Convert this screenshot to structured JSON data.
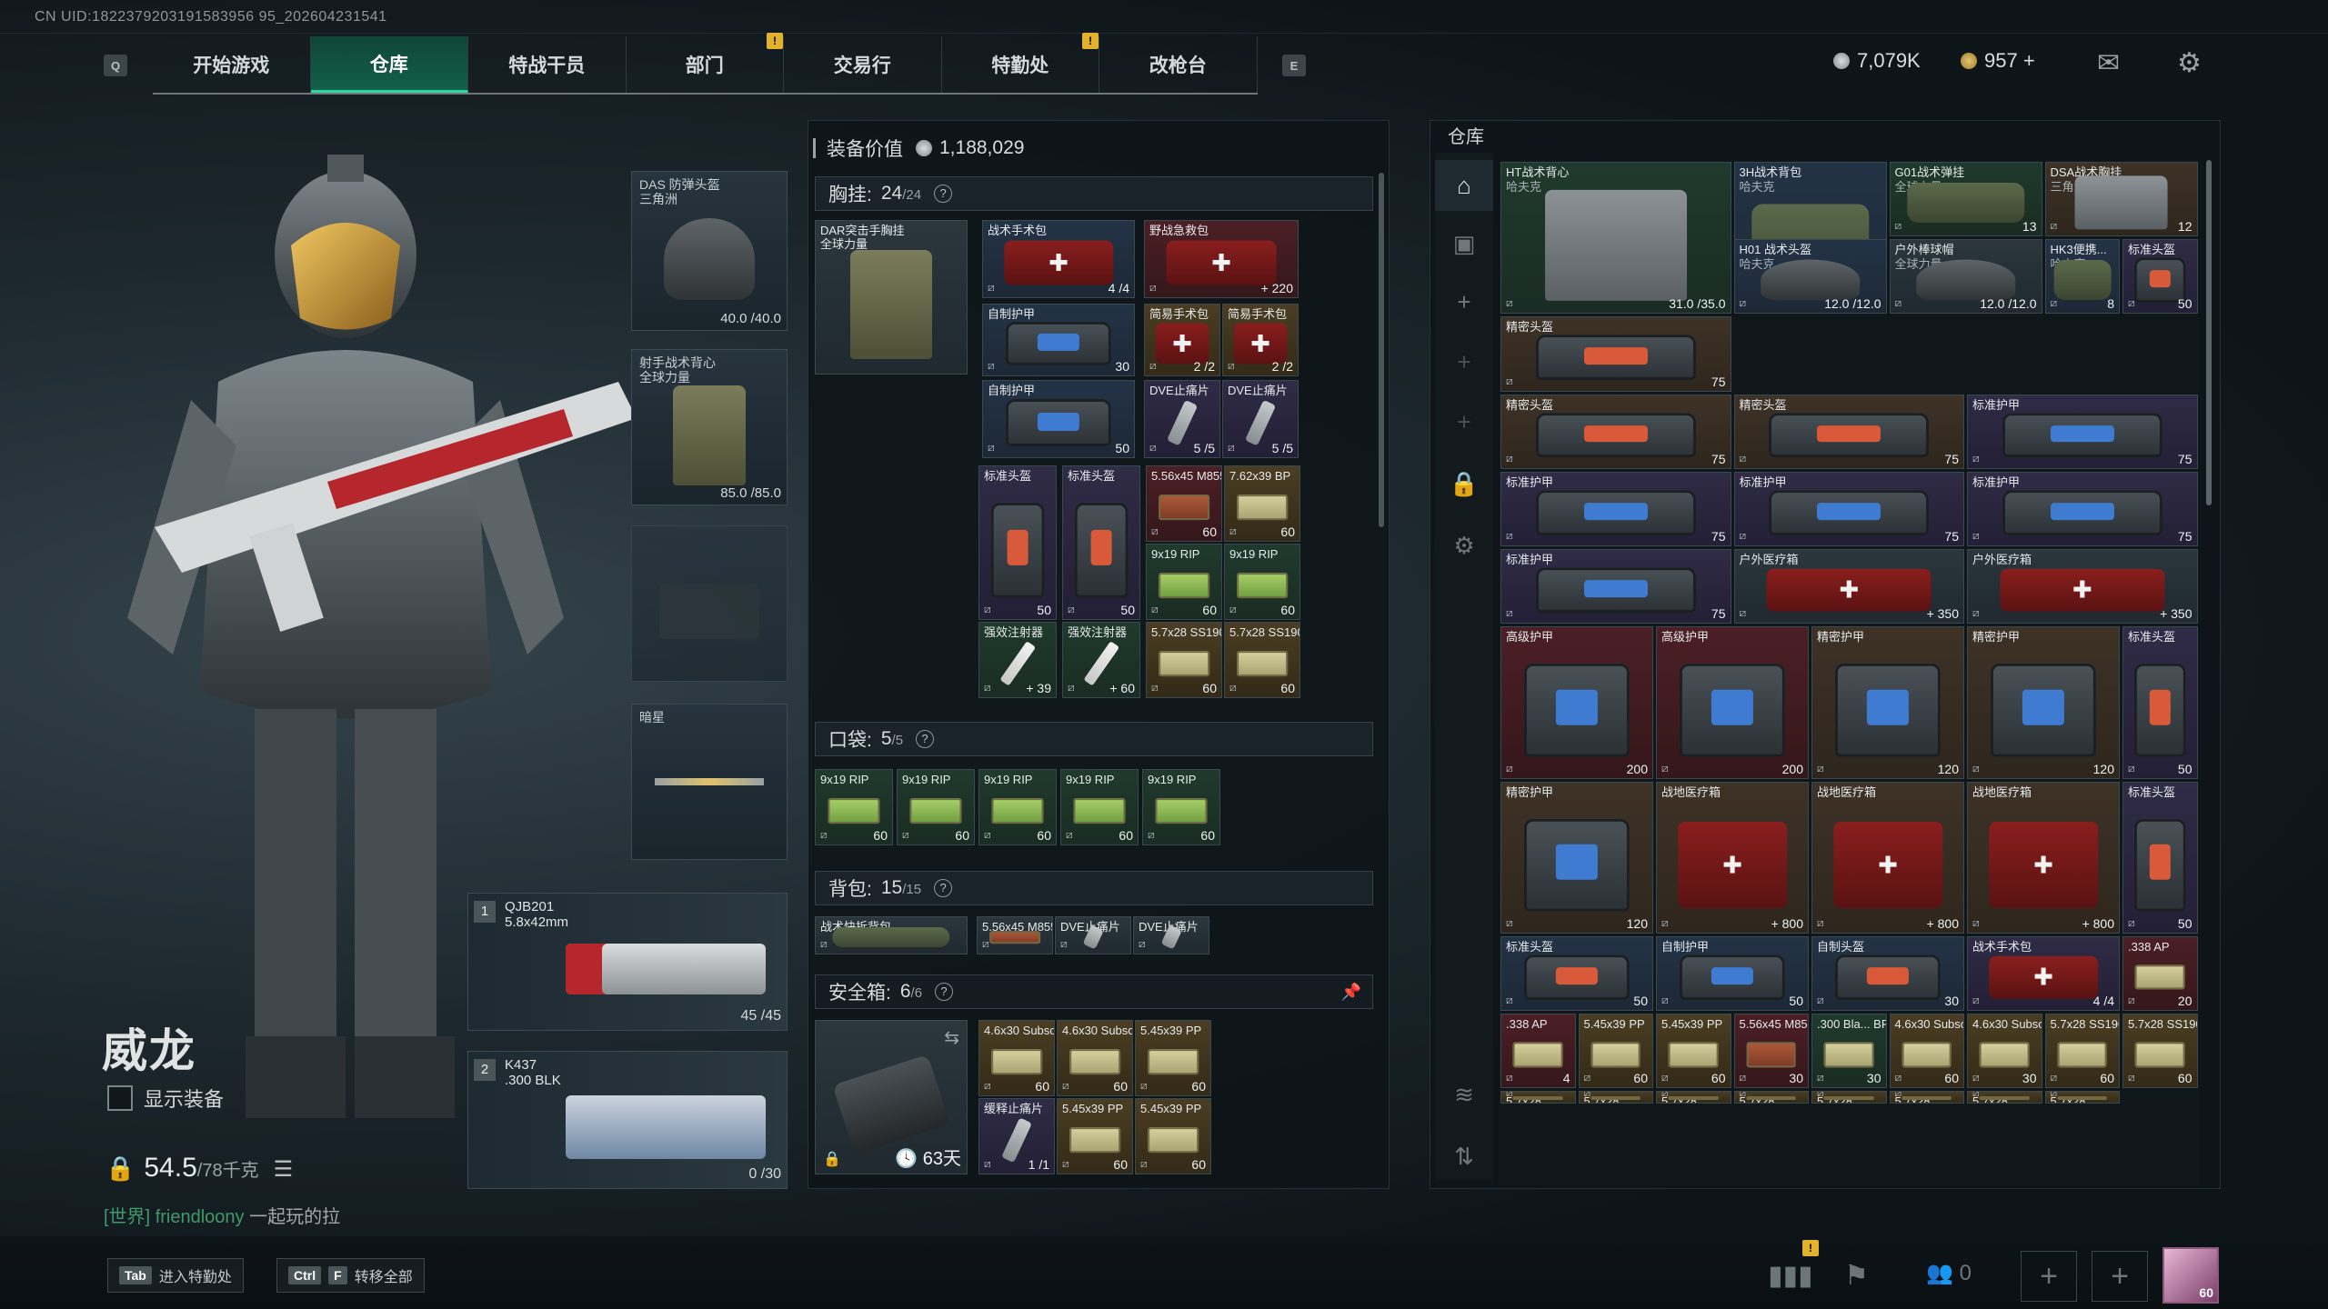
{
  "uid": "CN UID:1822379203191583956 95_202604231541",
  "keys": {
    "left": "Q",
    "right": "E"
  },
  "tabs": [
    "开始游戏",
    "仓库",
    "特战干员",
    "部门",
    "交易行",
    "特勤处",
    "改枪台"
  ],
  "currency": {
    "coins": "7,079K",
    "bonds": "957 +"
  },
  "character": {
    "name": "威龙",
    "show_equipment": "显示装备",
    "weight": "54.5",
    "weight_max": "/78千克",
    "chat_channel": "[世界]",
    "chat_user": "friendloony",
    "chat_msg": "一起玩的拉"
  },
  "equip": {
    "helmet": {
      "name": "DAS 防弹头盔",
      "sub": "三角洲",
      "durability": "40.0 /40.0"
    },
    "armor": {
      "name": "射手战术背心",
      "sub": "全球力量",
      "durability": "85.0 /85.0"
    },
    "melee": {
      "name": "暗星"
    }
  },
  "weapons": [
    {
      "num": "1",
      "name": "QJB201",
      "caliber": "5.8x42mm",
      "ammo": "45 /45"
    },
    {
      "num": "2",
      "name": "K437",
      "caliber": ".300 BLK",
      "ammo": "0 /30"
    }
  ],
  "middle": {
    "value_label": "装备价值",
    "value": "1,188,029",
    "chest": {
      "label": "胸挂:",
      "count": "24",
      "max": "/24",
      "rig_name": "DAR突击手胸挂",
      "rig_sub": "全球力量"
    },
    "pocket": {
      "label": "口袋:",
      "count": "5",
      "max": "/5"
    },
    "backpack": {
      "label": "背包:",
      "count": "15",
      "max": "/15"
    },
    "safe": {
      "label": "安全箱:",
      "count": "6",
      "max": "/6",
      "days": "63天"
    }
  },
  "chest_items": [
    {
      "t": "战术手术包",
      "n": "4 /4"
    },
    {
      "t": "野战急救包",
      "n": "+ 220"
    },
    {
      "t": "自制护甲",
      "n": "30"
    },
    {
      "t": "简易手术包",
      "n": "2 /2"
    },
    {
      "t": "简易手术包",
      "n": "2 /2"
    },
    {
      "t": "自制护甲",
      "n": "50"
    },
    {
      "t": "DVE止痛片",
      "n": "5 /5"
    },
    {
      "t": "DVE止痛片",
      "n": "5 /5"
    },
    {
      "t": "标准头盔",
      "n": "50"
    },
    {
      "t": "标准头盔",
      "n": "50"
    },
    {
      "t": "5.56x45 M855A1",
      "n": "60"
    },
    {
      "t": "7.62x39 BP",
      "n": "60"
    },
    {
      "t": "9x19 RIP",
      "n": "60"
    },
    {
      "t": "9x19 RIP",
      "n": "60"
    },
    {
      "t": "强效注射器",
      "n": "+ 39"
    },
    {
      "t": "强效注射器",
      "n": "+ 60"
    },
    {
      "t": "5.7x28 SS190",
      "n": "60"
    },
    {
      "t": "5.7x28 SS190",
      "n": "60"
    }
  ],
  "pocket_items": [
    {
      "t": "9x19 RIP",
      "n": "60"
    },
    {
      "t": "9x19 RIP",
      "n": "60"
    },
    {
      "t": "9x19 RIP",
      "n": "60"
    },
    {
      "t": "9x19 RIP",
      "n": "60"
    },
    {
      "t": "9x19 RIP",
      "n": "60"
    }
  ],
  "backpack_items": [
    {
      "t": "战术快拆背包"
    },
    {
      "t": "5.56x45 M855A1"
    },
    {
      "t": "DVE止痛片"
    },
    {
      "t": "DVE止痛片"
    }
  ],
  "safe_items": [
    {
      "t": "4.6x30 Subsonic",
      "n": "60"
    },
    {
      "t": "4.6x30 Subsonic",
      "n": "60"
    },
    {
      "t": "5.45x39 PP",
      "n": "60"
    },
    {
      "t": "缓释止痛片",
      "n": "1 /1"
    },
    {
      "t": "5.45x39 PP",
      "n": "60"
    },
    {
      "t": "5.45x39 PP",
      "n": "60"
    }
  ],
  "stash": {
    "title": "仓库",
    "items": [
      {
        "t": "HT战术背心",
        "s": "哈夫克",
        "n": "31.0 /35.0"
      },
      {
        "t": "3H战术背包",
        "s": "哈夫克",
        "n": "18"
      },
      {
        "t": "G01战术弹挂",
        "s": "全球力量",
        "n": "13"
      },
      {
        "t": "DSA战术胸挂",
        "s": "三角洲",
        "n": "12"
      },
      {
        "t": "H01 战术头盔",
        "s": "哈夫克",
        "n": "12.0 /12.0"
      },
      {
        "t": "户外棒球帽",
        "s": "全球力量",
        "n": "12.0 /12.0"
      },
      {
        "t": "HK3便携...",
        "s": "哈夫克",
        "n": "8"
      },
      {
        "t": "标准头盔",
        "s": "",
        "n": "50"
      },
      {
        "t": "精密头盔",
        "n": "75"
      },
      {
        "t": "精密头盔",
        "n": "75"
      },
      {
        "t": "精密头盔",
        "n": "75"
      },
      {
        "t": "标准护甲",
        "n": "75"
      },
      {
        "t": "标准护甲",
        "n": "75"
      },
      {
        "t": "标准护甲",
        "n": "75"
      },
      {
        "t": "标准护甲",
        "n": "75"
      },
      {
        "t": "标准护甲",
        "n": "75"
      },
      {
        "t": "户外医疗箱",
        "n": "+ 350"
      },
      {
        "t": "户外医疗箱",
        "n": "+ 350"
      },
      {
        "t": "高级护甲",
        "n": "200"
      },
      {
        "t": "高级护甲",
        "n": "200"
      },
      {
        "t": "精密护甲",
        "n": "120"
      },
      {
        "t": "精密护甲",
        "n": "120"
      },
      {
        "t": "标准头盔",
        "n": "50"
      },
      {
        "t": "精密护甲",
        "n": "120"
      },
      {
        "t": "战地医疗箱",
        "n": "+ 800"
      },
      {
        "t": "战地医疗箱",
        "n": "+ 800"
      },
      {
        "t": "战地医疗箱",
        "n": "+ 800"
      },
      {
        "t": "标准头盔",
        "n": "50"
      },
      {
        "t": "标准头盔",
        "n": "50"
      },
      {
        "t": "自制护甲",
        "n": "50"
      },
      {
        "t": "自制头盔",
        "n": "30"
      },
      {
        "t": "战术手术包",
        "n": "4 /4"
      },
      {
        "t": ".338 AP",
        "n": "20"
      },
      {
        "t": ".338 AP",
        "n": "4"
      },
      {
        "t": "5.45x39 PP",
        "n": "60"
      },
      {
        "t": "5.45x39 PP",
        "n": "60"
      },
      {
        "t": "5.56x45 M855",
        "n": "30"
      },
      {
        "t": ".300 Bla... BP/ADMJ",
        "n": "30"
      },
      {
        "t": "4.6x30 Subsonic",
        "n": "60"
      },
      {
        "t": "4.6x30 Subsonic",
        "n": "30"
      },
      {
        "t": "5.7x28 SS190",
        "n": "60"
      },
      {
        "t": "5.7x28 SS190",
        "n": "60"
      },
      {
        "t": "5.7x28"
      },
      {
        "t": "5.7x28"
      },
      {
        "t": "5.7x28"
      },
      {
        "t": "5.7x28"
      },
      {
        "t": "5.7x28"
      },
      {
        "t": "5.7x28"
      },
      {
        "t": "5.7x28"
      },
      {
        "t": "5.7x28"
      }
    ]
  },
  "bottom": {
    "tab_label": "进入特勤处",
    "tab_key": "Tab",
    "ctrl_key": "Ctrl",
    "f_key": "F",
    "ctrl_label": "转移全部",
    "friends": "0",
    "level": "60"
  }
}
